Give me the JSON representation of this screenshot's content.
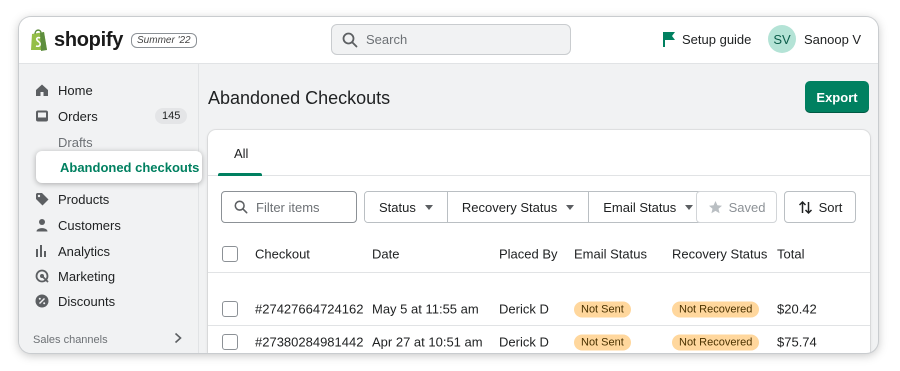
{
  "topbar": {
    "brand": "shopify",
    "edition_badge": "Summer '22",
    "search_placeholder": "Search",
    "setup_guide": "Setup guide",
    "user_initials": "SV",
    "user_name": "Sanoop V"
  },
  "sidebar": {
    "items": [
      {
        "label": "Home",
        "icon": "home-icon"
      },
      {
        "label": "Orders",
        "icon": "inbox-icon",
        "badge": "145"
      },
      {
        "label": "Drafts"
      },
      {
        "label": "Abandoned checkouts"
      },
      {
        "label": "Products",
        "icon": "tag-icon"
      },
      {
        "label": "Customers",
        "icon": "person-icon"
      },
      {
        "label": "Analytics",
        "icon": "bar-chart-icon"
      },
      {
        "label": "Marketing",
        "icon": "target-icon"
      },
      {
        "label": "Discounts",
        "icon": "discount-icon"
      }
    ],
    "sales_channels": "Sales channels"
  },
  "main": {
    "title": "Abandoned Checkouts",
    "export_label": "Export",
    "tabs": [
      {
        "label": "All"
      }
    ],
    "filter_placeholder": "Filter items",
    "filters": [
      "Status",
      "Recovery Status",
      "Email Status"
    ],
    "saved_label": "Saved",
    "sort_label": "Sort",
    "columns": [
      "Checkout",
      "Date",
      "Placed By",
      "Email Status",
      "Recovery Status",
      "Total"
    ],
    "rows": [
      {
        "checkout": "#27427664724162",
        "date": "May 5 at 11:55 am",
        "placed_by": "Derick D",
        "email_status": "Not Sent",
        "recovery_status": "Not Recovered",
        "total": "$20.42"
      },
      {
        "checkout": "#27380284981442",
        "date": "Apr 27 at 10:51 am",
        "placed_by": "Derick D",
        "email_status": "Not Sent",
        "recovery_status": "Not Recovered",
        "total": "$75.74"
      }
    ]
  },
  "colors": {
    "accent": "#008060",
    "status_pill": "#ffd79d",
    "avatar_bg": "#b4e3d6"
  }
}
